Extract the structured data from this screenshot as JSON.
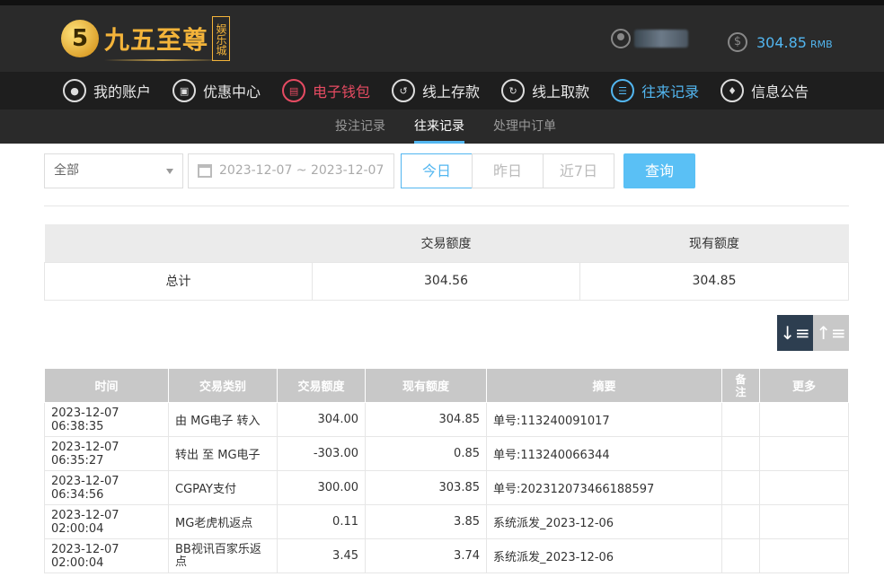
{
  "brand": {
    "logo_mark": "5",
    "name": "九五至尊",
    "badge": "娱乐城"
  },
  "account": {
    "balance": "304.85",
    "currency": "RMB",
    "user_icon": "user-icon",
    "coin_icon": "coin-icon"
  },
  "nav": [
    {
      "label": "我的账户",
      "icon": "account-icon",
      "state": "normal"
    },
    {
      "label": "优惠中心",
      "icon": "gift-icon",
      "state": "normal"
    },
    {
      "label": "电子钱包",
      "icon": "wallet-icon",
      "state": "red"
    },
    {
      "label": "线上存款",
      "icon": "deposit-icon",
      "state": "normal"
    },
    {
      "label": "线上取款",
      "icon": "withdraw-icon",
      "state": "normal"
    },
    {
      "label": "往来记录",
      "icon": "records-icon",
      "state": "active"
    },
    {
      "label": "信息公告",
      "icon": "bell-icon",
      "state": "normal"
    }
  ],
  "subnav": [
    {
      "label": "投注记录",
      "active": false
    },
    {
      "label": "往来记录",
      "active": true
    },
    {
      "label": "处理中订单",
      "active": false
    }
  ],
  "filter": {
    "type_value": "全部",
    "date_range": "2023-12-07 ~ 2023-12-07",
    "quick": [
      "今日",
      "昨日",
      "近7日"
    ],
    "quick_active": "今日",
    "query_label": "查询"
  },
  "summary": {
    "headers": [
      "",
      "交易额度",
      "现有额度"
    ],
    "row": [
      "总计",
      "304.56",
      "304.85"
    ]
  },
  "records": {
    "headers": [
      "时间",
      "交易类别",
      "交易额度",
      "现有额度",
      "摘要",
      "备注",
      "更多"
    ],
    "rows": [
      [
        "2023-12-07 06:38:35",
        "由 MG电子 转入",
        "304.00",
        "304.85",
        "单号:113240091017",
        "",
        ""
      ],
      [
        "2023-12-07 06:35:27",
        "转出 至 MG电子",
        "-303.00",
        "0.85",
        "单号:113240066344",
        "",
        ""
      ],
      [
        "2023-12-07 06:34:56",
        "CGPAY支付",
        "300.00",
        "303.85",
        "单号:202312073466188597",
        "",
        ""
      ],
      [
        "2023-12-07 02:00:04",
        "MG老虎机返点",
        "0.11",
        "3.85",
        "系统派发_2023-12-06",
        "",
        ""
      ],
      [
        "2023-12-07 02:00:04",
        "BB视讯百家乐返点",
        "3.45",
        "3.74",
        "系统派发_2023-12-06",
        "",
        ""
      ]
    ]
  },
  "colors": {
    "accent": "#52b6f0",
    "alert": "#e64b62",
    "header_bg": "#2a2a2a"
  }
}
